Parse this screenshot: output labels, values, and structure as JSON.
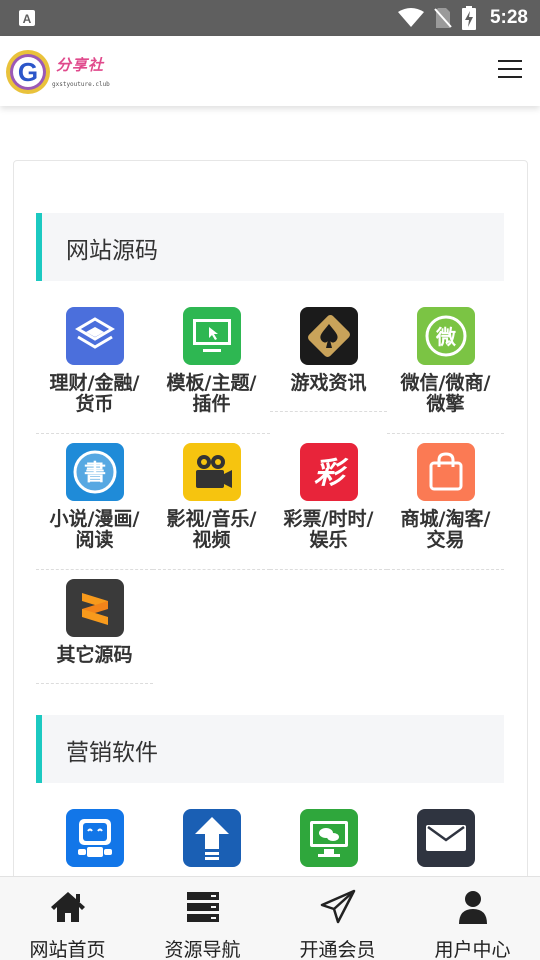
{
  "status_bar": {
    "time": "5:28"
  },
  "header": {
    "logo_text": "分享社",
    "logo_subtext": "gxstyouture.club"
  },
  "sections": [
    {
      "title": "网站源码",
      "items": [
        {
          "label_line1": "理财/金融/",
          "label_line2": "货币",
          "icon": "layers-icon",
          "color": "#4b6fdc"
        },
        {
          "label_line1": "模板/主题/",
          "label_line2": "插件",
          "icon": "monitor-cursor-icon",
          "color": "#2eb752"
        },
        {
          "label_line1": "游戏资讯",
          "label_line2": "",
          "icon": "spade-card-icon",
          "color": "#1b1b1b"
        },
        {
          "label_line1": "微信/微商/",
          "label_line2": "微擎",
          "icon": "wei-icon",
          "color": "#7bc444"
        },
        {
          "label_line1": "小说/漫画/",
          "label_line2": "阅读",
          "icon": "book-icon",
          "color": "#1f8bd8"
        },
        {
          "label_line1": "影视/音乐/",
          "label_line2": "视频",
          "icon": "film-camera-icon",
          "color": "#f6c40f"
        },
        {
          "label_line1": "彩票/时时/",
          "label_line2": "娱乐",
          "icon": "lottery-icon",
          "color": "#e8243a"
        },
        {
          "label_line1": "商城/淘客/",
          "label_line2": "交易",
          "icon": "shopping-bag-icon",
          "color": "#fb7a54"
        },
        {
          "label_line1": "其它源码",
          "label_line2": "",
          "icon": "sublime-icon",
          "color": "#3a3a3a"
        }
      ]
    },
    {
      "title": "营销软件",
      "items": [
        {
          "icon": "robot-icon",
          "color": "#1276e8"
        },
        {
          "icon": "upload-arrow-icon",
          "color": "#1a5fb4"
        },
        {
          "icon": "wechat-monitor-icon",
          "color": "#2fa73c"
        },
        {
          "icon": "mail-icon",
          "color": "#2f3440"
        }
      ]
    }
  ],
  "tabs": [
    {
      "label": "网站首页",
      "icon": "home-icon"
    },
    {
      "label": "资源导航",
      "icon": "server-icon"
    },
    {
      "label": "开通会员",
      "icon": "paper-plane-icon"
    },
    {
      "label": "用户中心",
      "icon": "user-icon"
    }
  ]
}
